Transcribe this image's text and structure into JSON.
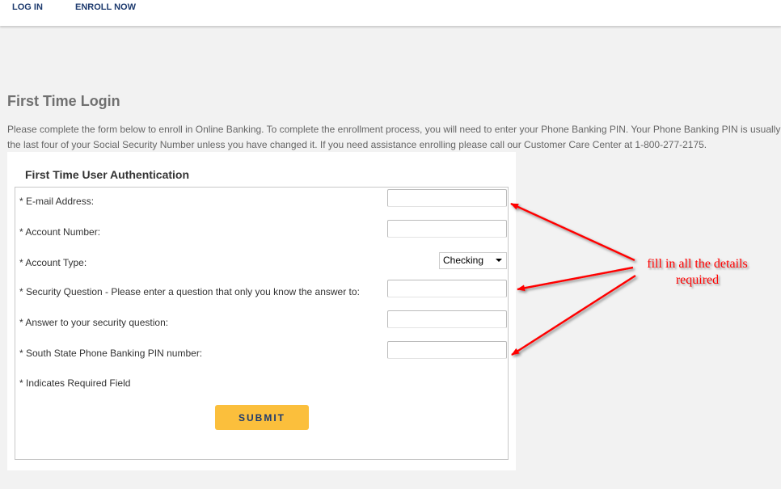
{
  "nav": {
    "login": "LOG IN",
    "enroll": "ENROLL NOW"
  },
  "page": {
    "title": "First Time Login",
    "intro_line1": "Please complete the form below to enroll in Online Banking. To complete the enrollment process, you will need to enter your Phone Banking PIN. Your Phone Banking PIN is usually",
    "intro_line2": "the last four of your Social Security Number unless you have changed it. If you need assistance enrolling please call our Customer Care Center at 1-800-277-2175."
  },
  "form": {
    "heading": "First Time User Authentication",
    "fields": [
      {
        "label": "* E-mail Address:",
        "value": ""
      },
      {
        "label": "* Account Number:",
        "value": ""
      },
      {
        "label": "* Account Type:",
        "value": "Checking"
      },
      {
        "label": "* Security Question - Please enter a question that only you know the answer to:",
        "value": ""
      },
      {
        "label": "* Answer to your security question:",
        "value": ""
      },
      {
        "label": "* South State Phone Banking PIN number:",
        "value": ""
      }
    ],
    "required_note": "* Indicates Required Field",
    "submit": "SUBMIT"
  },
  "annotation": {
    "line1": "fill in all the details",
    "line2": "required",
    "color": "#ff0000"
  },
  "colors": {
    "accent": "#fbbf3c",
    "nav": "#1d3a6e"
  }
}
